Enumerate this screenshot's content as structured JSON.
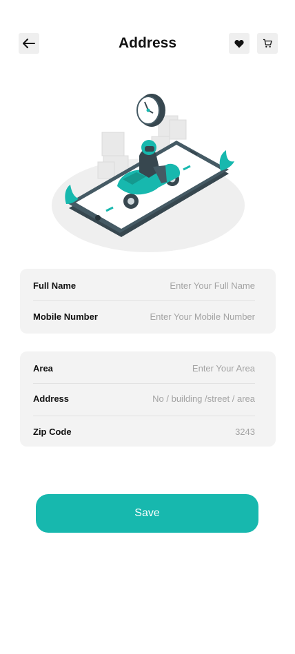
{
  "header": {
    "title": "Address",
    "back_icon": "arrow-left-icon",
    "favorite_icon": "heart-icon",
    "cart_icon": "cart-icon"
  },
  "contact_card": {
    "full_name": {
      "label": "Full Name",
      "placeholder": "Enter Your Full Name",
      "value": ""
    },
    "mobile": {
      "label": "Mobile Number",
      "placeholder": "Enter Your Mobile Number",
      "value": ""
    }
  },
  "address_card": {
    "area": {
      "label": "Area",
      "placeholder": "Enter Your Area",
      "value": ""
    },
    "address": {
      "label": "Address",
      "placeholder": "No / building /street / area",
      "value": ""
    },
    "zip": {
      "label": "Zip Code",
      "placeholder": "3243",
      "value": ""
    }
  },
  "save_button": {
    "label": "Save"
  },
  "colors": {
    "accent": "#17b8ae",
    "card_bg": "#f3f3f3",
    "dark": "#37474f"
  }
}
